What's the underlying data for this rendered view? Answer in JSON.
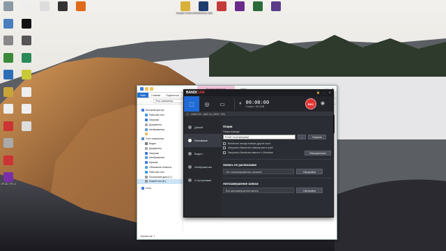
{
  "colors": {
    "bandicam_accent": "#1f6ad6",
    "rec_red": "#e03434",
    "explorer_file_tab": "#1f6fd1",
    "context_tab_pink": "#f7c9e0"
  },
  "desktop_icons": {
    "col1": [
      {
        "label": "",
        "icon": "recycle-bin-icon",
        "color": "#8c9aa6"
      },
      {
        "label": "",
        "icon": "app-icon",
        "color": "#4a7fbf"
      },
      {
        "label": "",
        "icon": "app-icon",
        "color": "#888"
      },
      {
        "label": "",
        "icon": "app-icon",
        "color": "#3a8a3a"
      },
      {
        "label": "",
        "icon": "app-icon",
        "color": "#2c6db5"
      },
      {
        "label": "",
        "icon": "app-icon",
        "color": "#c9a43a"
      },
      {
        "label": "",
        "icon": "document-icon",
        "color": "#eee"
      },
      {
        "label": "",
        "icon": "app-icon",
        "color": "#c33"
      },
      {
        "label": "",
        "icon": "app-icon",
        "color": "#aaa"
      },
      {
        "label": "",
        "icon": "app-icon",
        "color": "#c33"
      },
      {
        "label": "CPUID CPU-Z",
        "icon": "cpu-z-icon",
        "color": "#7a2fa8"
      }
    ],
    "col2": [
      {
        "label": "",
        "icon": "document-icon",
        "color": "#eee"
      },
      {
        "label": "",
        "icon": "app-icon",
        "color": "#111"
      },
      {
        "label": "",
        "icon": "app-icon",
        "color": "#555"
      },
      {
        "label": "",
        "icon": "app-icon",
        "color": "#2a8a5a"
      },
      {
        "label": "",
        "icon": "app-icon",
        "color": "#c9c93a"
      },
      {
        "label": "",
        "icon": "document-icon",
        "color": "#eee"
      },
      {
        "label": "",
        "icon": "document-icon",
        "color": "#eee"
      },
      {
        "label": "",
        "icon": "app-icon",
        "color": "#ddd"
      }
    ],
    "top_row": [
      {
        "label": "",
        "icon": "app-icon",
        "color": "#ddd"
      },
      {
        "label": "",
        "icon": "app-icon",
        "color": "#333"
      },
      {
        "label": "",
        "icon": "app-icon",
        "color": "#e06a1a"
      },
      {
        "label": "Google Chrome",
        "icon": "chrome-icon",
        "color": "#d9b13a"
      },
      {
        "label": "Photoshop CS6",
        "icon": "photoshop-icon",
        "color": "#1d3d6e"
      },
      {
        "label": "",
        "icon": "app-icon",
        "color": "#c43a3a"
      },
      {
        "label": "",
        "icon": "app-icon",
        "color": "#6a2a8a"
      },
      {
        "label": "",
        "icon": "app-icon",
        "color": "#2a6a3a"
      },
      {
        "label": "",
        "icon": "app-icon",
        "color": "#5a3a8a"
      }
    ]
  },
  "explorer": {
    "context_tab": "Воспроизведение",
    "title": "pets2",
    "ribbon_tabs": [
      "Файл",
      "Главная",
      "Поделиться",
      "Вид"
    ],
    "address": "Этот компьютер",
    "nav": [
      {
        "label": "Быстрый доступ",
        "indent": false,
        "color": "#3d7be0"
      },
      {
        "label": "Рабочий стол",
        "indent": true,
        "color": "#3d9be0"
      },
      {
        "label": "Загрузки",
        "indent": true,
        "color": "#3d7be0"
      },
      {
        "label": "Документы",
        "indent": true,
        "color": "#aaa"
      },
      {
        "label": "Изображения",
        "indent": true,
        "color": "#5aa0d0"
      },
      {
        "label": "",
        "indent": true,
        "color": "#e9c25a"
      },
      {
        "label": "Этот компьютер",
        "indent": false,
        "color": "#5a8ac0"
      },
      {
        "label": "Видео",
        "indent": true,
        "color": "#777"
      },
      {
        "label": "Документы",
        "indent": true,
        "color": "#aaa"
      },
      {
        "label": "Загрузки",
        "indent": true,
        "color": "#3d7be0"
      },
      {
        "label": "Изображения",
        "indent": true,
        "color": "#5aa0d0"
      },
      {
        "label": "Музыка",
        "indent": true,
        "color": "#3d7be0"
      },
      {
        "label": "Объемные объекты",
        "indent": true,
        "color": "#5aa0d0"
      },
      {
        "label": "Рабочий стол",
        "indent": true,
        "color": "#3d9be0"
      },
      {
        "label": "Локальный диск (C:)",
        "indent": true,
        "color": "#999"
      },
      {
        "label": "Новый том (E:)",
        "indent": true,
        "color": "#999",
        "selected": true
      },
      {
        "gap": true
      },
      {
        "label": "Сеть",
        "indent": false,
        "color": "#3d7be0"
      }
    ],
    "status": "Элементов: 7"
  },
  "bandicam": {
    "logo_main": "BANDI",
    "logo_accent": "CAM",
    "modes": [
      {
        "name": "rectangle-mode",
        "glyph": "⬚",
        "active": true
      },
      {
        "name": "game-mode",
        "glyph": "🎮",
        "active": false
      },
      {
        "name": "device-mode",
        "glyph": "▭",
        "active": false
      }
    ],
    "timer": "00:00:00",
    "size": "0 bytes / 55.4GB",
    "rec_label": "REC",
    "resolution": "1280x720 - (640, 0), (1920, 720)",
    "sidebar": [
      {
        "label": "Домой",
        "active": false
      },
      {
        "label": "Основные",
        "active": true
      },
      {
        "label": "Видео",
        "active": false
      },
      {
        "label": "Изображения",
        "active": false
      },
      {
        "label": "О программе",
        "active": false
      }
    ],
    "options": {
      "title": "Опции",
      "output_label": "Папка вывода",
      "output_path": "E:\\HD YouTube\\pets2",
      "dots": "...",
      "open_label": "Открыть",
      "checks": [
        "Bandicam всегда поверх других окон",
        "Запускать Bandicam свёрнутым в трей",
        "Запускать Bandicam вместе с Windows"
      ],
      "advanced_label": "Расширенные"
    },
    "schedule": {
      "title": "Запись по расписанию",
      "value": "Нет запланированных записей",
      "button": "Настройки"
    },
    "autocomplete": {
      "title": "Автозавершение записи",
      "value": "Без автозавершения записи",
      "button": "Настройки"
    }
  }
}
